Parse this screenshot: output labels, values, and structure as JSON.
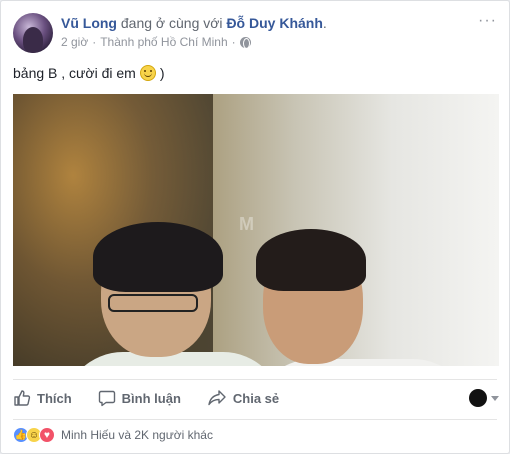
{
  "post": {
    "author": "Vũ Long",
    "with_text": "đang ở cùng với",
    "tagged": "Đỗ Duy Khánh",
    "tagged_suffix": ".",
    "time": "2 giờ",
    "separator": "·",
    "location": "Thành phố Hồ Chí Minh",
    "separator2": "·",
    "privacy_icon": "globe-icon",
    "more_label": "···",
    "status_text": "bảng B , cười đi em",
    "status_emoji": "smiley-icon",
    "status_suffix": ")",
    "photo_watermark": "M"
  },
  "actions": {
    "like_label": "Thích",
    "comment_label": "Bình luận",
    "share_label": "Chia sẻ"
  },
  "reactions": {
    "summary": "Minh Hiếu và 2K người khác",
    "icons": [
      "like-icon",
      "haha-icon",
      "love-icon"
    ],
    "colors": {
      "like": "#5890ff",
      "haha": "#f7d34a",
      "love": "#f25268"
    }
  },
  "colors": {
    "link": "#365899",
    "muted": "#616770",
    "meta": "#90949c"
  }
}
